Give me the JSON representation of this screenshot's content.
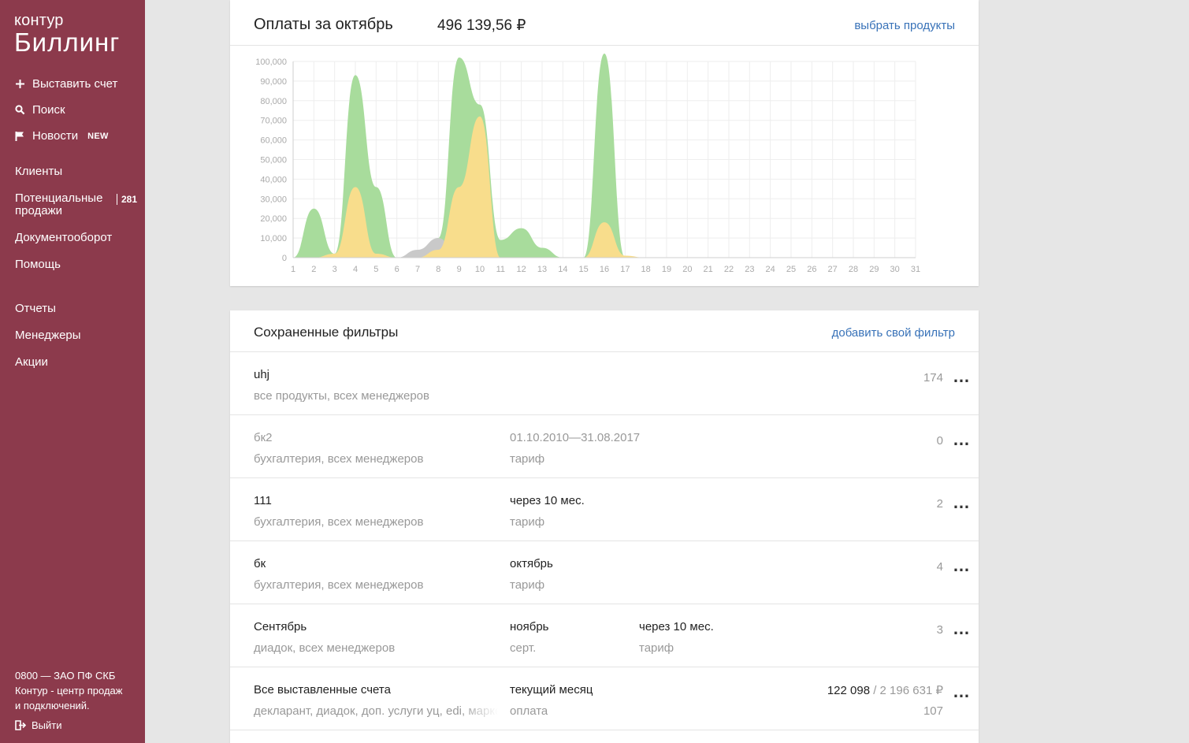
{
  "brand": {
    "top": "контур",
    "main": "Биллинг"
  },
  "quick_actions": [
    {
      "label": "Выставить счет",
      "icon": "plus-icon"
    },
    {
      "label": "Поиск",
      "icon": "search-icon"
    },
    {
      "label": "Новости",
      "icon": "flag-icon",
      "badge": "NEW"
    }
  ],
  "nav": {
    "clients": "Клиенты",
    "potential": "Потенциальные продажи",
    "potential_count": "281",
    "docs": "Документооборот",
    "help": "Помощь",
    "reports": "Отчеты",
    "managers": "Менеджеры",
    "promos": "Акции"
  },
  "footer": {
    "line1": "0800 — ЗАО ПФ СКБ",
    "line2": "Контур - центр продаж",
    "line3": "и подключений.",
    "logout": "Выйти"
  },
  "payments": {
    "title": "Оплаты за октябрь",
    "amount": "496 139,56 ₽",
    "choose_link": "выбрать продукты"
  },
  "chart_data": {
    "type": "area",
    "x": [
      1,
      2,
      3,
      4,
      5,
      6,
      7,
      8,
      9,
      10,
      11,
      12,
      13,
      14,
      15,
      16,
      17,
      18,
      19,
      20,
      21,
      22,
      23,
      24,
      25,
      26,
      27,
      28,
      29,
      30,
      31
    ],
    "ylim": [
      0,
      100000
    ],
    "yticks": [
      0,
      10000,
      20000,
      30000,
      40000,
      50000,
      60000,
      70000,
      80000,
      90000,
      100000
    ],
    "ytick_labels": [
      "0",
      "10,000",
      "20,000",
      "30,000",
      "40,000",
      "50,000",
      "60,000",
      "70,000",
      "80,000",
      "90,000",
      "100,000"
    ],
    "grid": true,
    "series": [
      {
        "color": "#a8dc9c",
        "values": [
          0,
          25000,
          2000,
          93000,
          36000,
          0,
          0,
          10000,
          102000,
          78000,
          9000,
          15000,
          5000,
          0,
          0,
          104000,
          0,
          0,
          0,
          0,
          0,
          0,
          0,
          0,
          0,
          0,
          0,
          0,
          0,
          0,
          0
        ]
      },
      {
        "color": "#c9c9c9",
        "values": [
          0,
          0,
          0,
          0,
          0,
          0,
          4000,
          10000,
          0,
          0,
          0,
          0,
          0,
          0,
          0,
          0,
          0,
          0,
          0,
          0,
          0,
          0,
          0,
          0,
          0,
          0,
          0,
          0,
          0,
          0,
          0
        ]
      },
      {
        "color": "#f8dd8c",
        "values": [
          0,
          0,
          2000,
          36000,
          2000,
          0,
          0,
          4000,
          36000,
          72000,
          0,
          0,
          0,
          0,
          0,
          18000,
          1000,
          0,
          0,
          0,
          0,
          0,
          0,
          0,
          0,
          0,
          0,
          0,
          0,
          0,
          0
        ]
      }
    ]
  },
  "filters": {
    "title": "Сохраненные фильтры",
    "add_link": "добавить свой фильтр",
    "rows": [
      {
        "name": "uhj",
        "desc": "все продукты, всех менеджеров",
        "p1": "",
        "p1_sub": "",
        "p2": "",
        "p2_sub": "",
        "count": "174"
      },
      {
        "name": "бк2",
        "desc": "бухгалтерия, всех менеджеров",
        "p1": "01.10.2010—31.08.2017",
        "p1_sub": "тариф",
        "p2": "",
        "p2_sub": "",
        "count": "0"
      },
      {
        "name": "111",
        "desc": "бухгалтерия, всех менеджеров",
        "p1": "через 10 мес.",
        "p1_sub": "тариф",
        "p2": "",
        "p2_sub": "",
        "count": "2"
      },
      {
        "name": "бк",
        "desc": "бухгалтерия, всех менеджеров",
        "p1": "октябрь",
        "p1_sub": "тариф",
        "p2": "",
        "p2_sub": "",
        "count": "4"
      },
      {
        "name": "Сентябрь",
        "desc": "диадок, всех менеджеров",
        "p1": "ноябрь",
        "p1_sub": "серт.",
        "p2": "через 10 мес.",
        "p2_sub": "тариф",
        "count": "3"
      },
      {
        "name": "Все выставленные счета",
        "desc": "декларант, диадок, доп. услуги уц, edi, маркет",
        "p1": "текущий месяц",
        "p1_sub": "оплата",
        "p2": "",
        "p2_sub": "",
        "amount": "122 098",
        "amount_total": " / 2 196 631 ₽",
        "count": "107"
      }
    ]
  }
}
